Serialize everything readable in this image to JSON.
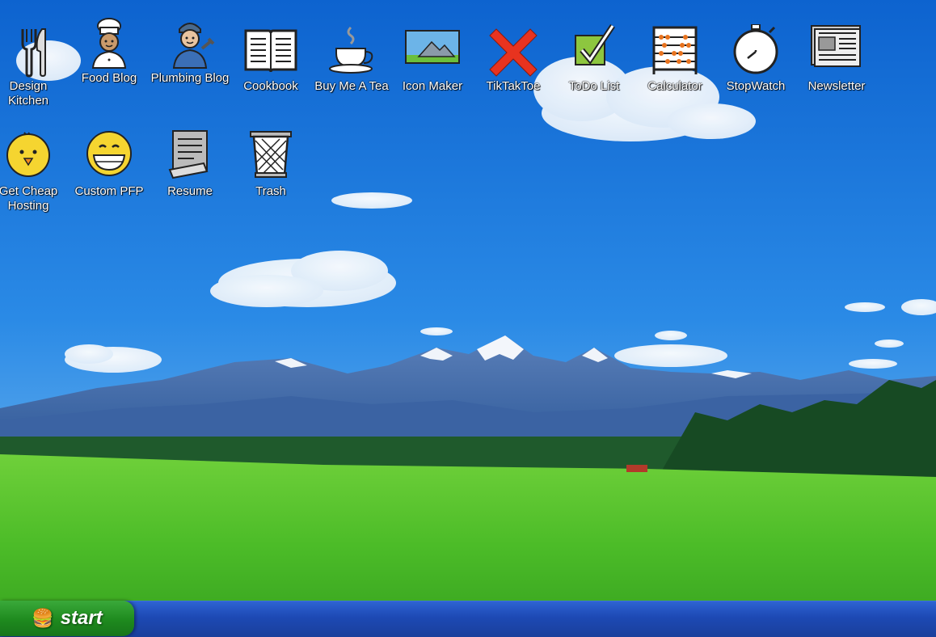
{
  "desktop": {
    "icons": [
      {
        "label": "Design Kitchen"
      },
      {
        "label": "Food Blog"
      },
      {
        "label": "Plumbing Blog"
      },
      {
        "label": "Cookbook"
      },
      {
        "label": "Buy Me A Tea"
      },
      {
        "label": "Icon Maker"
      },
      {
        "label": "TikTakToe"
      },
      {
        "label": "ToDo List"
      },
      {
        "label": "Calculator"
      },
      {
        "label": "StopWatch"
      },
      {
        "label": "Newsletter"
      },
      {
        "label": "Get Cheap Hosting"
      },
      {
        "label": "Custom PFP"
      },
      {
        "label": "Resume"
      },
      {
        "label": "Trash"
      }
    ]
  },
  "taskbar": {
    "start_label": "start",
    "start_icon": "🍔"
  },
  "colors": {
    "sky": "#1f79d9",
    "grass": "#4fbb2a",
    "taskbar": "#1d49b4",
    "start": "#1e8a1e"
  }
}
